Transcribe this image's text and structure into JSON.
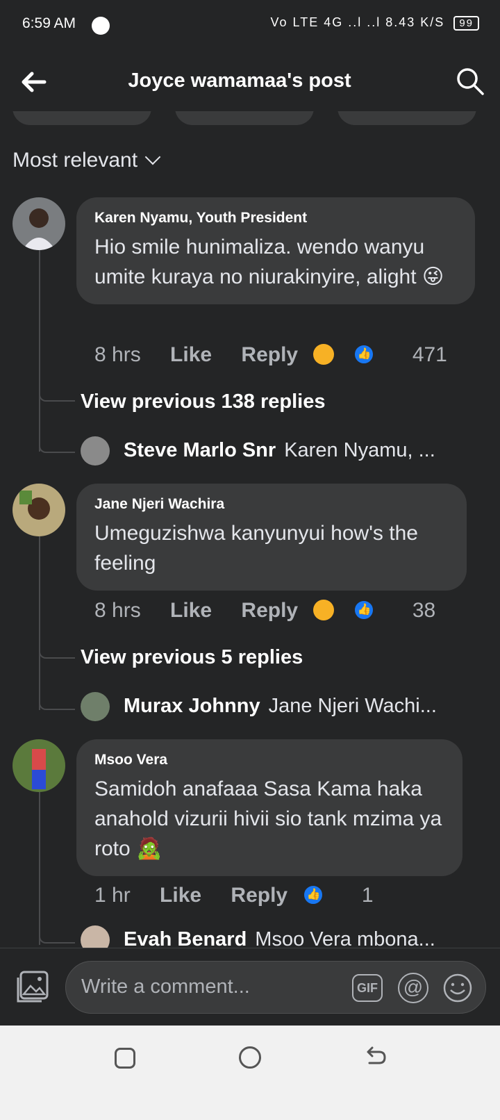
{
  "status": {
    "time": "6:59 AM",
    "icons": " Vo LTE 4G ..l ..l 8.43 K/S",
    "battery": "99"
  },
  "header": {
    "title": "Joyce wamamaa's post"
  },
  "sort": {
    "label": "Most relevant"
  },
  "comments": [
    {
      "name": "Karen Nyamu, Youth President",
      "text": "Hio smile hunimaliza. wendo wanyu umite kuraya no niurakinyire, alight 😜",
      "time": "8 hrs",
      "like": "Like",
      "reply": "Reply",
      "count": "471",
      "view_prev": "View previous 138 replies",
      "reply_name": "Steve Marlo Snr",
      "reply_text": "Karen Nyamu, ..."
    },
    {
      "name": "Jane Njeri Wachira",
      "text": "Umeguzishwa kanyunyui how's the feeling",
      "time": "8 hrs",
      "like": "Like",
      "reply": "Reply",
      "count": "38",
      "view_prev": "View previous 5 replies",
      "reply_name": "Murax Johnny",
      "reply_text": "Jane Njeri Wachi..."
    },
    {
      "name": "Msoo Vera",
      "text": "Samidoh anafaaa Sasa Kama haka anahold vizurii hivii sio tank mzima ya roto 🧟",
      "time": "1 hr",
      "like": "Like",
      "reply": "Reply",
      "count": "1",
      "reply_name": "Evah Benard",
      "reply_text": "Msoo Vera mbona..."
    }
  ],
  "composer": {
    "placeholder": "Write a comment...",
    "gif": "GIF",
    "at": "@"
  },
  "colors": {
    "bg": "#242526",
    "bubble": "#3a3b3c",
    "like_blue": "#1877f2",
    "haha_yellow": "#f7b125"
  }
}
